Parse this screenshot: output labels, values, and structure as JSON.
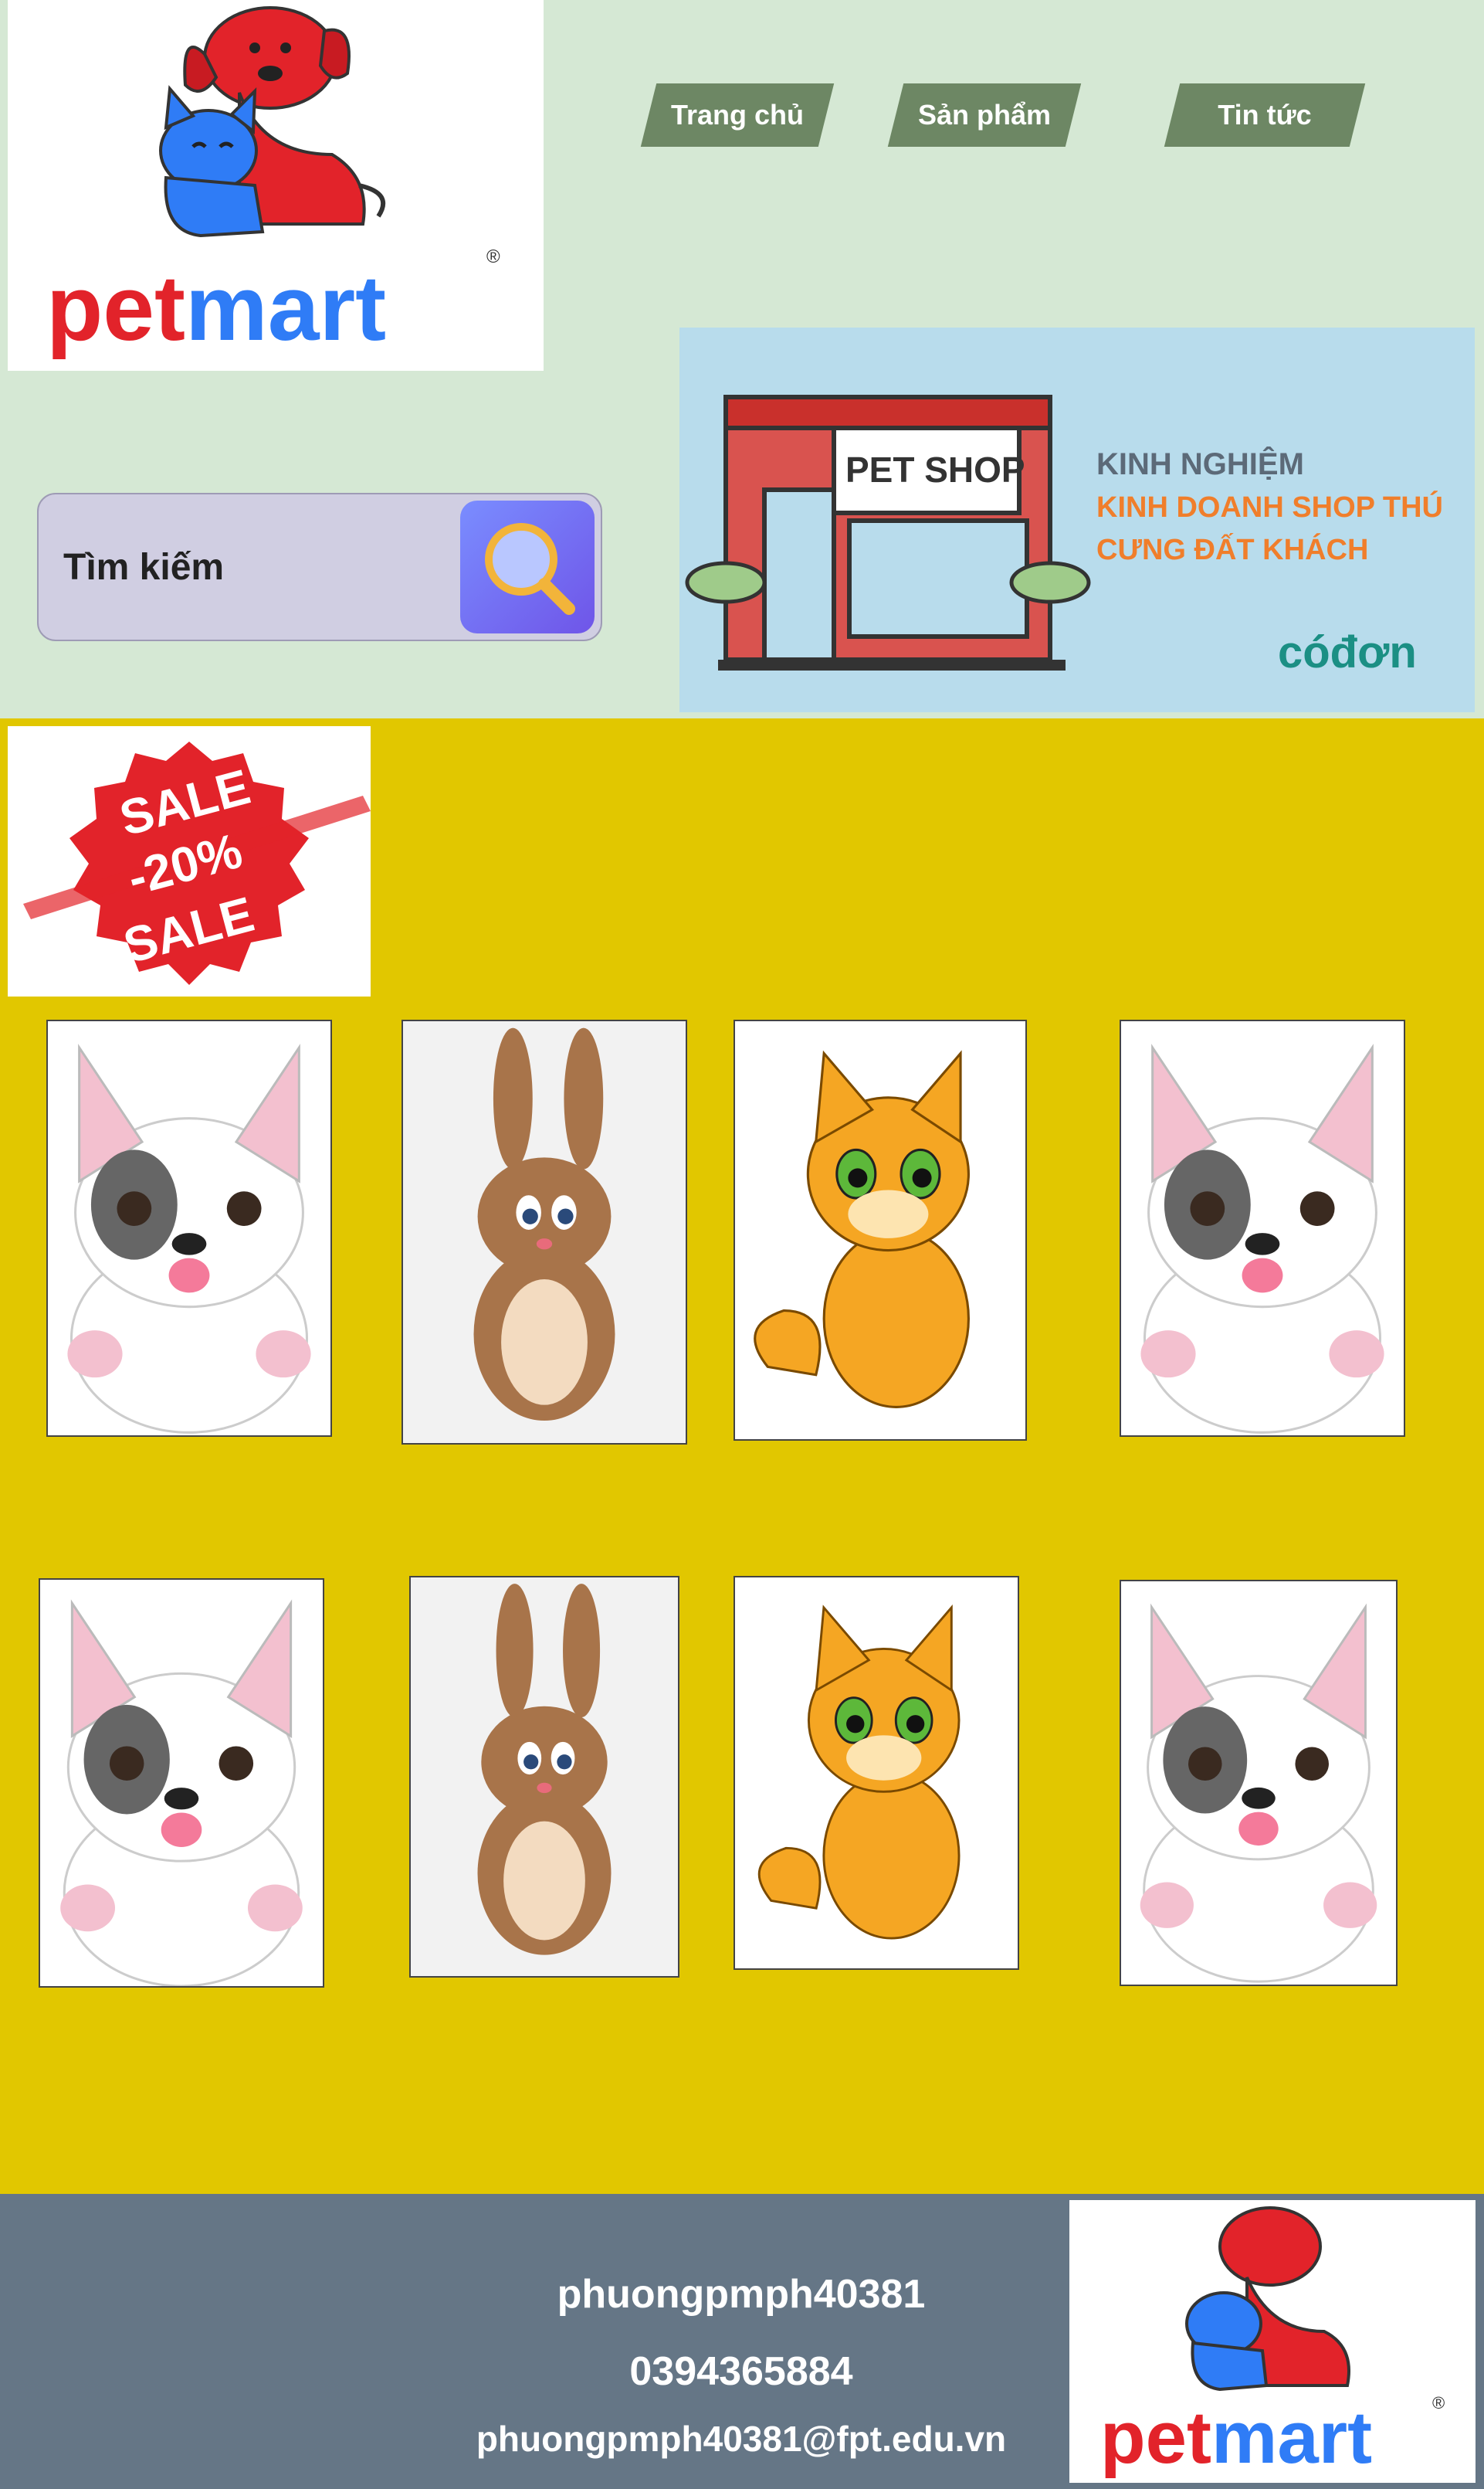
{
  "brand": {
    "logo_text": "petmart"
  },
  "nav": {
    "items": [
      "Trang chủ",
      "Sản phẩm",
      "Tin tức"
    ]
  },
  "search": {
    "label": "Tìm kiếm"
  },
  "banner": {
    "sign": "PET SHOP",
    "line1": "KINH NGHIỆM",
    "line2": "KINH DOANH SHOP THÚ",
    "line3": "CƯNG ĐẤT KHÁCH",
    "brand": "cóđơn"
  },
  "sale": {
    "top": "SALE",
    "discount": "-20%",
    "bottom": "SALE"
  },
  "products": {
    "row1": [
      "puppy-image",
      "bunny-image",
      "kitten-image",
      "puppy-image"
    ],
    "row2": [
      "puppy-image",
      "bunny-image",
      "kitten-image",
      "puppy-image"
    ]
  },
  "footer": {
    "username": "phuongpmph40381",
    "phone": "0394365884",
    "email": "phuongpmph40381@fpt.edu.vn"
  },
  "colors": {
    "header_bg": "#d5e8d4",
    "main_bg": "#e1c700",
    "nav_btn": "#6d8764",
    "search_bg": "#d0cee2",
    "footer_bg": "#657686",
    "brand_red": "#e2232a",
    "brand_blue": "#2f7cf6"
  }
}
